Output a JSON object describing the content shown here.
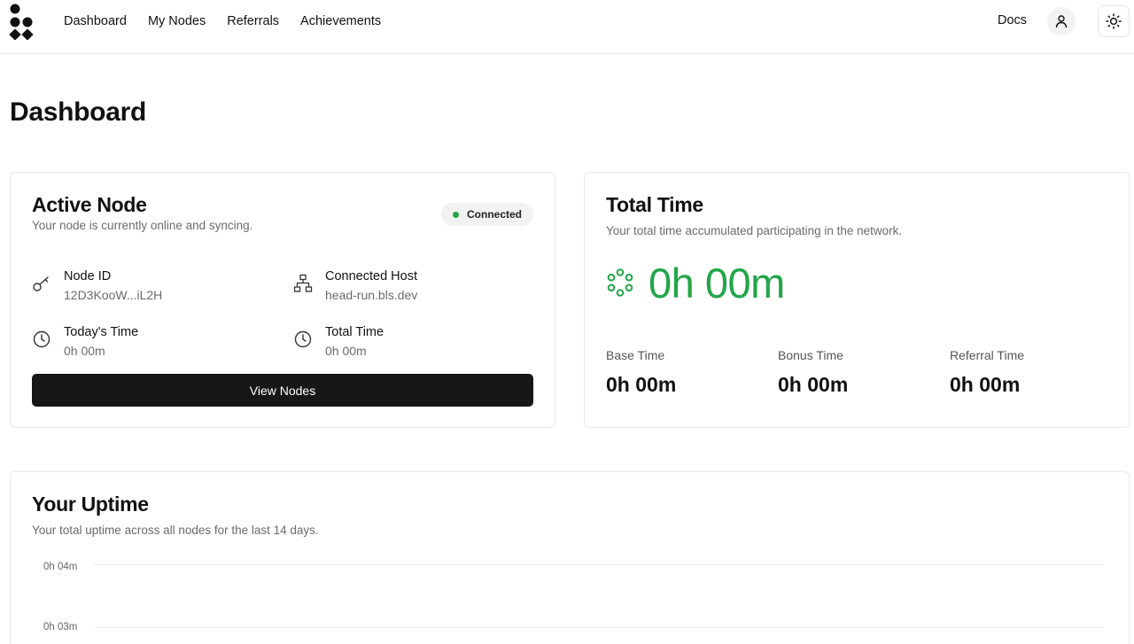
{
  "nav": {
    "items": [
      "Dashboard",
      "My Nodes",
      "Referrals",
      "Achievements"
    ],
    "docs": "Docs"
  },
  "page": {
    "title": "Dashboard"
  },
  "active_node": {
    "title": "Active Node",
    "subtitle": "Your node is currently online and syncing.",
    "status": "Connected",
    "status_color": "#22a548",
    "node_id_label": "Node ID",
    "node_id_value": "12D3KooW...iL2H",
    "host_label": "Connected Host",
    "host_value": "head-run.bls.dev",
    "today_label": "Today's Time",
    "today_value": "0h 00m",
    "total_label": "Total Time",
    "total_value": "0h 00m",
    "button": "View Nodes"
  },
  "total_time": {
    "title": "Total Time",
    "subtitle": "Your total time accumulated participating in the network.",
    "value": "0h 00m",
    "base_label": "Base Time",
    "base_value": "0h 00m",
    "bonus_label": "Bonus Time",
    "bonus_value": "0h 00m",
    "referral_label": "Referral Time",
    "referral_value": "0h 00m"
  },
  "uptime": {
    "title": "Your Uptime",
    "subtitle": "Your total uptime across all nodes for the last 14 days.",
    "y_ticks": [
      "0h 04m",
      "0h 03m"
    ]
  },
  "colors": {
    "accent": "#22a548",
    "button_bg": "#171717"
  },
  "icons": {
    "logo": "blockchain-dots-logo",
    "user": "user-icon",
    "theme": "sun-icon",
    "node_id": "key-icon",
    "host": "network-icon",
    "clock": "clock-icon",
    "total": "flower-ring-icon"
  }
}
